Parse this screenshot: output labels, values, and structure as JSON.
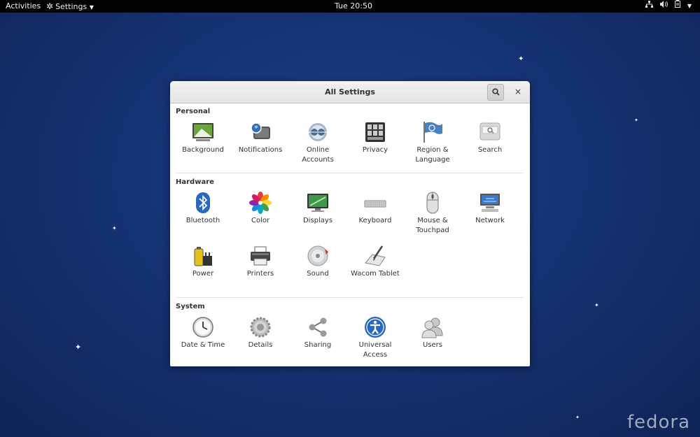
{
  "topbar": {
    "activities": "Activities",
    "app_menu": "Settings",
    "clock": "Tue 20:50",
    "tray_icons": [
      "network-icon",
      "volume-icon",
      "battery-icon"
    ]
  },
  "window": {
    "title": "All Settings",
    "search_icon": "search-icon",
    "close_label": "×"
  },
  "sections": {
    "personal": {
      "title": "Personal",
      "items": [
        {
          "label_1": "Background",
          "label_2": ""
        },
        {
          "label_1": "Notifications",
          "label_2": ""
        },
        {
          "label_1": "Online",
          "label_2": "Accounts"
        },
        {
          "label_1": "Privacy",
          "label_2": ""
        },
        {
          "label_1": "Region &",
          "label_2": "Language"
        },
        {
          "label_1": "Search",
          "label_2": ""
        }
      ]
    },
    "hardware": {
      "title": "Hardware",
      "items": [
        {
          "label_1": "Bluetooth",
          "label_2": ""
        },
        {
          "label_1": "Color",
          "label_2": ""
        },
        {
          "label_1": "Displays",
          "label_2": ""
        },
        {
          "label_1": "Keyboard",
          "label_2": ""
        },
        {
          "label_1": "Mouse &",
          "label_2": "Touchpad"
        },
        {
          "label_1": "Network",
          "label_2": ""
        },
        {
          "label_1": "Power",
          "label_2": ""
        },
        {
          "label_1": "Printers",
          "label_2": ""
        },
        {
          "label_1": "Sound",
          "label_2": ""
        },
        {
          "label_1": "Wacom Tablet",
          "label_2": ""
        }
      ]
    },
    "system": {
      "title": "System",
      "items": [
        {
          "label_1": "Date & Time",
          "label_2": ""
        },
        {
          "label_1": "Details",
          "label_2": ""
        },
        {
          "label_1": "Sharing",
          "label_2": ""
        },
        {
          "label_1": "Universal",
          "label_2": "Access"
        },
        {
          "label_1": "Users",
          "label_2": ""
        }
      ]
    }
  },
  "wallpaper_brand": "fedora"
}
